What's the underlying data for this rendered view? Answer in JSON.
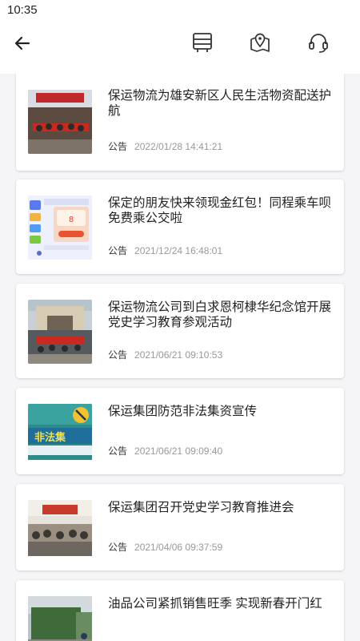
{
  "status_bar": {
    "time": "10:35"
  },
  "toolbar": {
    "back_icon": "arrow-left-icon",
    "actions": [
      "bus-icon",
      "map-pin-icon",
      "headset-icon"
    ]
  },
  "news": [
    {
      "title": "保运物流为雄安新区人民生活物资配送护航",
      "tag": "公告",
      "date": "2022/01/28 14:41:21"
    },
    {
      "title": "保定的朋友快来领现金红包！同程乘车呗免费乘公交啦",
      "tag": "公告",
      "date": "2021/12/24 16:48:01"
    },
    {
      "title": "保运物流公司到白求恩柯棣华纪念馆开展党史学习教育参观活动",
      "tag": "公告",
      "date": "2021/06/21 09:10:53"
    },
    {
      "title": "保运集团防范非法集资宣传",
      "tag": "公告",
      "date": "2021/06/21 09:09:40"
    },
    {
      "title": "保运集团召开党史学习教育推进会",
      "tag": "公告",
      "date": "2021/04/06 09:37:59"
    },
    {
      "title": "油品公司紧抓销售旺季 实现新春开门红",
      "tag": "",
      "date": ""
    }
  ],
  "colors": {
    "accent_red": "#c8281e",
    "text": "#222222",
    "muted": "#999999"
  }
}
